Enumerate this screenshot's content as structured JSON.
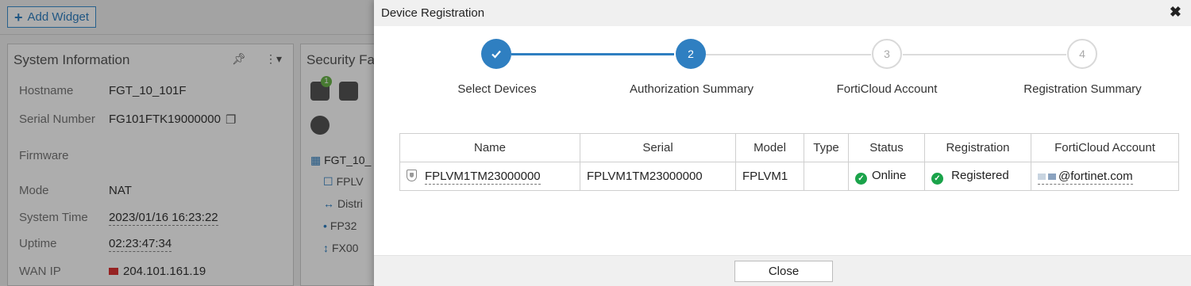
{
  "toolbar": {
    "add_widget_label": "Add Widget"
  },
  "system_information": {
    "title": "System Information",
    "rows": [
      {
        "key": "Hostname",
        "value": "FGT_10_101F"
      },
      {
        "key": "Serial Number",
        "value": "FG101FTK19000000"
      },
      {
        "key": "Firmware",
        "value": ""
      },
      {
        "key": "Mode",
        "value": "NAT"
      },
      {
        "key": "System Time",
        "value": "2023/01/16 16:23:22"
      },
      {
        "key": "Uptime",
        "value": "02:23:47:34"
      },
      {
        "key": "WAN IP",
        "value": "204.101.161.19"
      }
    ]
  },
  "security_fabric": {
    "title": "Security Fa",
    "badge": "1",
    "tree_root": "FGT_10_",
    "tree_items": [
      "FPLV",
      "Distri",
      "FP32",
      "FX00"
    ]
  },
  "dialog": {
    "title": "Device Registration",
    "steps": [
      {
        "label": "Select Devices",
        "number": "1",
        "state": "done"
      },
      {
        "label": "Authorization Summary",
        "number": "2",
        "state": "active"
      },
      {
        "label": "FortiCloud Account",
        "number": "3",
        "state": "todo"
      },
      {
        "label": "Registration Summary",
        "number": "4",
        "state": "todo"
      }
    ],
    "table": {
      "columns": [
        "Name",
        "Serial",
        "Model",
        "Type",
        "Status",
        "Registration",
        "FortiCloud Account"
      ],
      "rows": [
        {
          "name": "FPLVM1TM23000000",
          "serial": "FPLVM1TM23000000",
          "model": "FPLVM1",
          "type": "",
          "status": "Online",
          "registration": "Registered",
          "account": "@fortinet.com"
        }
      ]
    },
    "close_label": "Close"
  },
  "colors": {
    "accent": "#2f7fc1",
    "success": "#1aa34a"
  }
}
